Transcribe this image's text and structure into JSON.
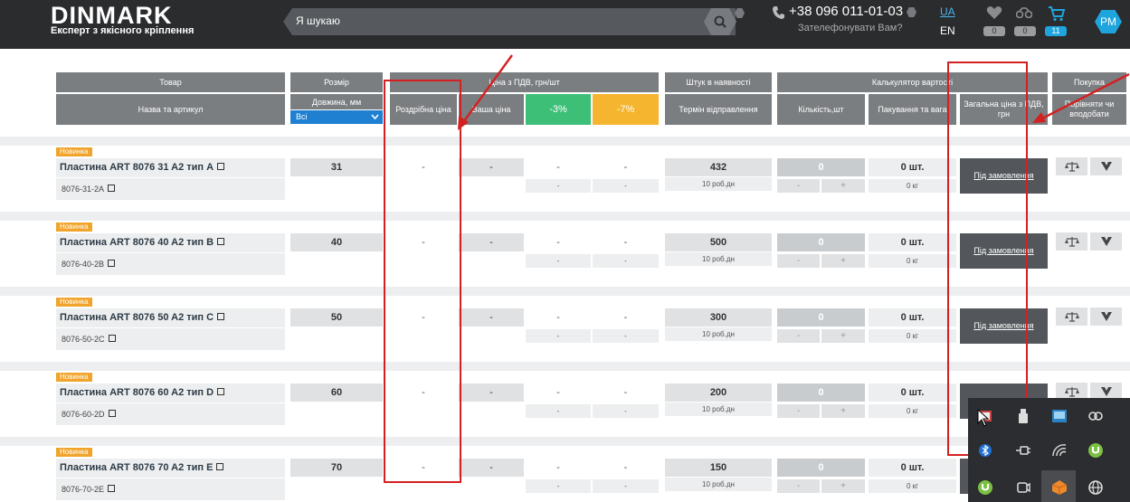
{
  "header": {
    "logo": "DINMARK",
    "tagline": "Експерт з якісного кріплення",
    "search_placeholder": "Я шукаю",
    "phone": "+38 096 011-01-03",
    "callback": "Зателефонувати Вам?",
    "lang_ua": "UA",
    "lang_en": "EN",
    "favorites_count": "0",
    "compare_count": "0",
    "cart_count": "11",
    "avatar": "PM"
  },
  "table_header": {
    "product": "Товар",
    "name_article": "Назва та артикул",
    "size": "Розмір",
    "length": "Довжина, мм",
    "length_filter": "Всі",
    "price_group": "Ціна з ПДВ, грн/шт",
    "retail_price": "Роздрібна ціна",
    "your_price": "Ваша ціна",
    "discount_3": "-3%",
    "discount_7": "-7%",
    "stock": "Штук в наявності",
    "dispatch": "Термін відправлення",
    "calculator": "Калькулятор вартості",
    "quantity": "Кількість,шт",
    "packaging": "Пакування та вага",
    "total": "Загальна ціна з ПДВ, грн",
    "purchase": "Покупка",
    "compare": "Порівняти чи вподобати"
  },
  "rows": [
    {
      "badge": "Новинка",
      "name": "Пластина ART 8076 31 A2 тип A",
      "article": "8076-31-2A",
      "size": "31",
      "retail": "-",
      "your": "-",
      "d3": "-",
      "d7": "-",
      "d3b": "-",
      "d7b": "-",
      "stock": "432",
      "dispatch": "10 роб.дн",
      "qty": "0",
      "minus": "-",
      "plus": "+",
      "pack": "0 шт.",
      "weight": "0 кг",
      "order": "Під замовлення"
    },
    {
      "badge": "Новинка",
      "name": "Пластина ART 8076 40 A2 тип B",
      "article": "8076-40-2B",
      "size": "40",
      "retail": "-",
      "your": "-",
      "d3": "-",
      "d7": "-",
      "d3b": "-",
      "d7b": "-",
      "stock": "500",
      "dispatch": "10 роб.дн",
      "qty": "0",
      "minus": "-",
      "plus": "+",
      "pack": "0 шт.",
      "weight": "0 кг",
      "order": "Під замовлення"
    },
    {
      "badge": "Новинка",
      "name": "Пластина ART 8076 50 A2 тип C",
      "article": "8076-50-2C",
      "size": "50",
      "retail": "-",
      "your": "-",
      "d3": "-",
      "d7": "-",
      "d3b": "-",
      "d7b": "-",
      "stock": "300",
      "dispatch": "10 роб.дн",
      "qty": "0",
      "minus": "-",
      "plus": "+",
      "pack": "0 шт.",
      "weight": "0 кг",
      "order": "Під замовлення"
    },
    {
      "badge": "Новинка",
      "name": "Пластина ART 8076 60 A2 тип D",
      "article": "8076-60-2D",
      "size": "60",
      "retail": "-",
      "your": "-",
      "d3": "-",
      "d7": "-",
      "d3b": "-",
      "d7b": "-",
      "stock": "200",
      "dispatch": "10 роб.дн",
      "qty": "0",
      "minus": "-",
      "plus": "+",
      "pack": "0 шт.",
      "weight": "0 кг",
      "order": ""
    },
    {
      "badge": "Новинка",
      "name": "Пластина ART 8076 70 A2 тип E",
      "article": "8076-70-2E",
      "size": "70",
      "retail": "-",
      "your": "-",
      "d3": "-",
      "d7": "-",
      "d3b": "-",
      "d7b": "-",
      "stock": "150",
      "dispatch": "10 роб.дн",
      "qty": "0",
      "minus": "-",
      "plus": "+",
      "pack": "0 шт.",
      "weight": "0 кг",
      "order": ""
    }
  ],
  "colors": {
    "header_bg": "#2b2c2e",
    "accent_blue": "#1fa5dd",
    "green": "#3dbf78",
    "orange": "#f5b52e",
    "annotation_red": "#d42020"
  }
}
